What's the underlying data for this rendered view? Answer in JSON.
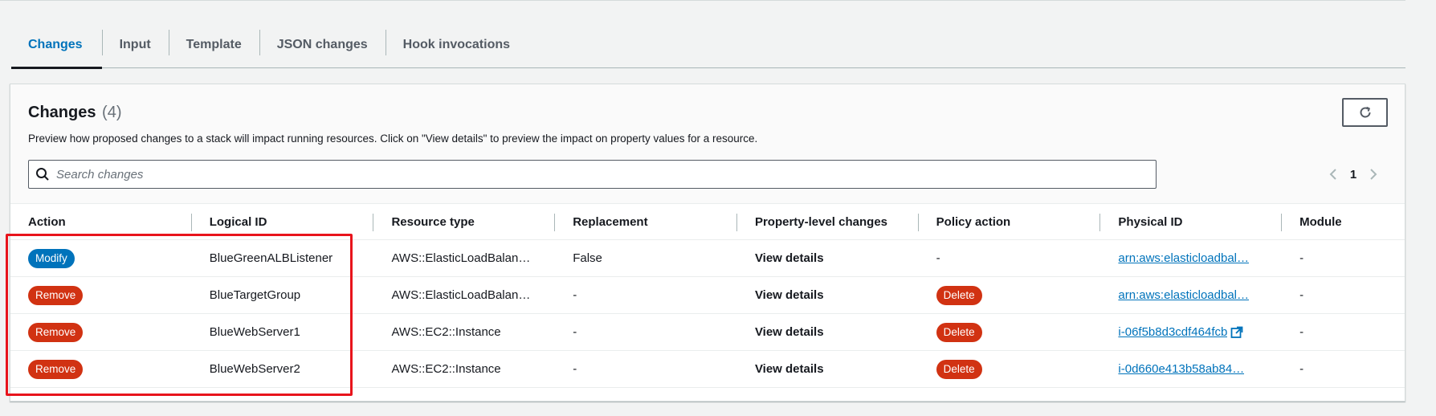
{
  "tabs": [
    {
      "label": "Changes",
      "active": true
    },
    {
      "label": "Input",
      "active": false
    },
    {
      "label": "Template",
      "active": false
    },
    {
      "label": "JSON changes",
      "active": false
    },
    {
      "label": "Hook invocations",
      "active": false
    }
  ],
  "panel": {
    "title": "Changes",
    "count": "(4)",
    "description": "Preview how proposed changes to a stack will impact running resources. Click on \"View details\" to preview the impact on property values for a resource.",
    "refresh_icon": "refresh-icon"
  },
  "search": {
    "placeholder": "Search changes",
    "value": "",
    "icon": "search-icon"
  },
  "pagination": {
    "current_page": "1",
    "prev_icon": "chevron-left-icon",
    "next_icon": "chevron-right-icon"
  },
  "table": {
    "headers": [
      "Action",
      "Logical ID",
      "Resource type",
      "Replacement",
      "Property-level changes",
      "Policy action",
      "Physical ID",
      "Module"
    ],
    "rows": [
      {
        "action": "Modify",
        "action_kind": "modify",
        "logical_id": "BlueGreenALBListener",
        "resource_type": "AWS::ElasticLoadBalan…",
        "replacement": "False",
        "property_changes": "View details",
        "policy_action": "-",
        "policy_badge": false,
        "physical_id": "arn:aws:elasticloadbal…",
        "external": false,
        "module": "-"
      },
      {
        "action": "Remove",
        "action_kind": "remove",
        "logical_id": "BlueTargetGroup",
        "resource_type": "AWS::ElasticLoadBalan…",
        "replacement": "-",
        "property_changes": "View details",
        "policy_action": "Delete",
        "policy_badge": true,
        "physical_id": "arn:aws:elasticloadbal…",
        "external": false,
        "module": "-"
      },
      {
        "action": "Remove",
        "action_kind": "remove",
        "logical_id": "BlueWebServer1",
        "resource_type": "AWS::EC2::Instance",
        "replacement": "-",
        "property_changes": "View details",
        "policy_action": "Delete",
        "policy_badge": true,
        "physical_id": "i-06f5b8d3cdf464fcb",
        "external": true,
        "module": "-"
      },
      {
        "action": "Remove",
        "action_kind": "remove",
        "logical_id": "BlueWebServer2",
        "resource_type": "AWS::EC2::Instance",
        "replacement": "-",
        "property_changes": "View details",
        "policy_action": "Delete",
        "policy_badge": true,
        "physical_id": "i-0d660e413b58ab84…",
        "external": false,
        "module": "-"
      }
    ]
  },
  "colors": {
    "accent": "#0073bb",
    "danger": "#d13212",
    "highlight": "#e8141c"
  }
}
